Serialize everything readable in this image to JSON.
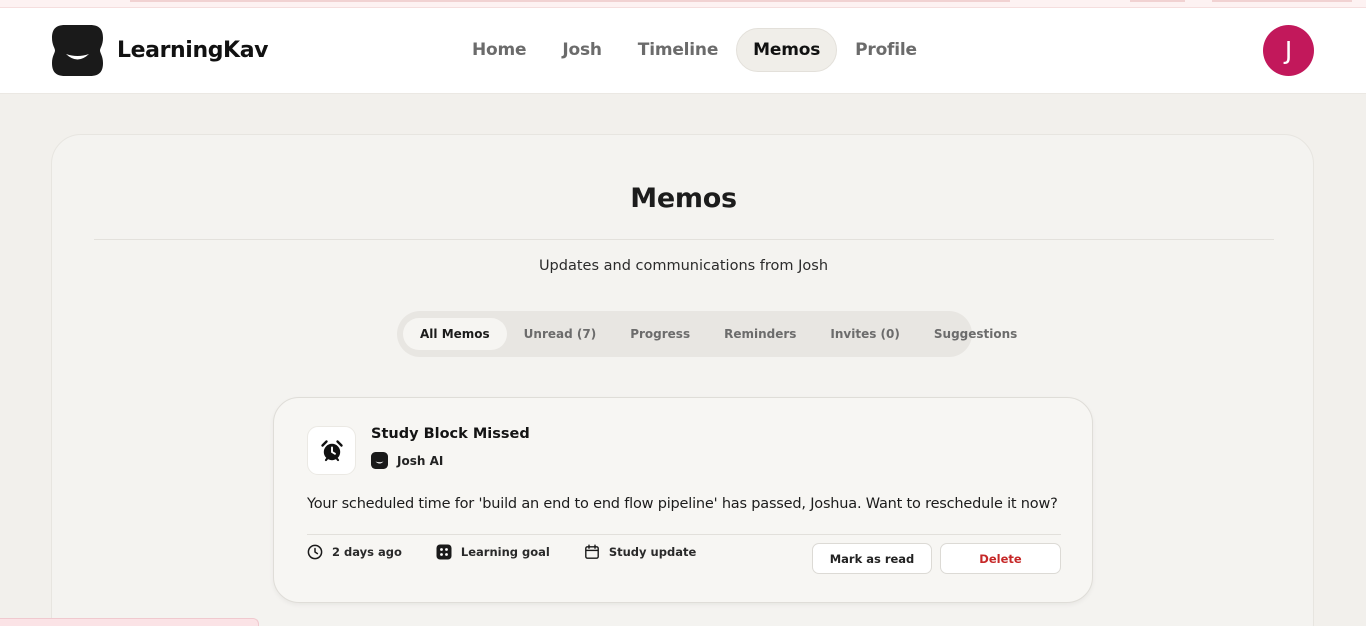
{
  "app": {
    "name": "LearningKav",
    "logo_icon": "smile-blob-logo"
  },
  "nav": {
    "items": [
      {
        "label": "Home",
        "active": false
      },
      {
        "label": "Josh",
        "active": false
      },
      {
        "label": "Timeline",
        "active": false
      },
      {
        "label": "Memos",
        "active": true
      },
      {
        "label": "Profile",
        "active": false
      }
    ]
  },
  "user": {
    "avatar_initial": "J",
    "avatar_color": "#c2185b"
  },
  "page": {
    "title": "Memos",
    "subtitle": "Updates and communications from Josh"
  },
  "tabs": [
    {
      "label": "All Memos",
      "active": true
    },
    {
      "label": "Unread (7)",
      "active": false
    },
    {
      "label": "Progress",
      "active": false
    },
    {
      "label": "Reminders",
      "active": false
    },
    {
      "label": "Invites (0)",
      "active": false
    },
    {
      "label": "Suggestions",
      "active": false
    }
  ],
  "memo": {
    "icon": "alarm-clock-icon",
    "title": "Study Block Missed",
    "from": "Josh AI",
    "body": "Your scheduled time for 'build an end to end flow pipeline' has passed, Joshua. Want to reschedule it now?",
    "meta": {
      "time": "2 days ago",
      "category": "Learning goal",
      "type": "Study update"
    },
    "actions": {
      "mark_read": "Mark as read",
      "delete": "Delete"
    }
  },
  "colors": {
    "accent": "#c2185b",
    "danger": "#c62828",
    "background": "#f2f0ec"
  }
}
